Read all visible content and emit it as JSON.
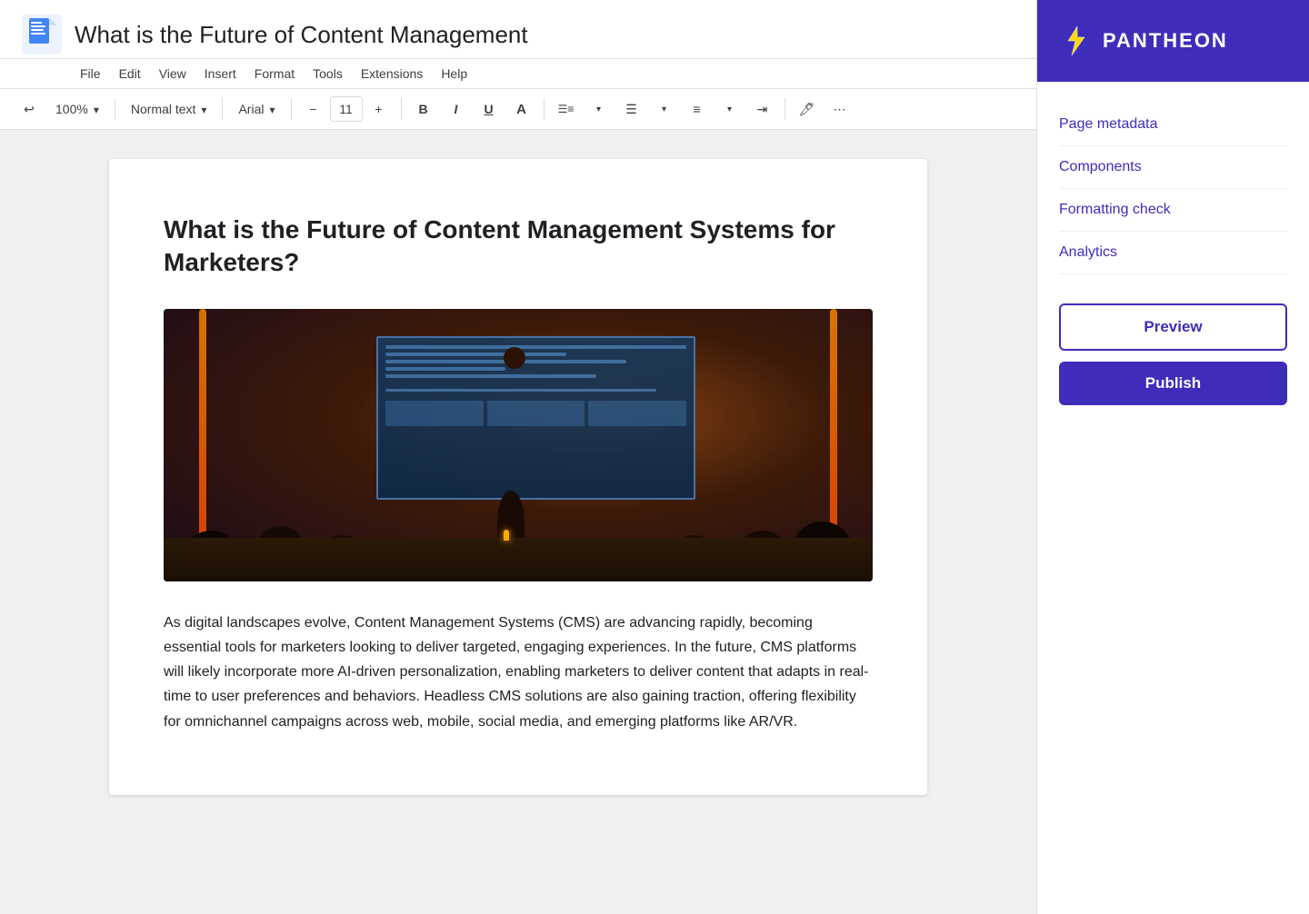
{
  "title_bar": {
    "doc_title": "What is the Future of Content Management"
  },
  "menu_bar": {
    "items": [
      "File",
      "Edit",
      "View",
      "Insert",
      "Format",
      "Tools",
      "Extensions",
      "Help"
    ]
  },
  "toolbar": {
    "zoom": "100%",
    "text_style": "Normal text",
    "font": "Arial",
    "font_size": "11",
    "bold": "B",
    "italic": "I",
    "underline": "U"
  },
  "document": {
    "heading": "What is the Future of Content Management Systems for Marketers?",
    "body_text": "As digital landscapes evolve, Content Management Systems (CMS) are advancing rapidly, becoming essential tools for marketers looking to deliver targeted, engaging experiences. In the future, CMS platforms will likely incorporate more AI-driven personalization, enabling marketers to deliver content that adapts in real-time to user preferences and behaviors. Headless CMS solutions are also gaining traction, offering flexibility for omnichannel campaigns across web, mobile, social media, and emerging platforms like AR/VR."
  },
  "sidebar": {
    "brand_name": "PANTHEON",
    "nav_items": [
      {
        "label": "Page metadata"
      },
      {
        "label": "Components"
      },
      {
        "label": "Formatting check"
      },
      {
        "label": "Analytics"
      }
    ],
    "preview_label": "Preview",
    "publish_label": "Publish"
  }
}
